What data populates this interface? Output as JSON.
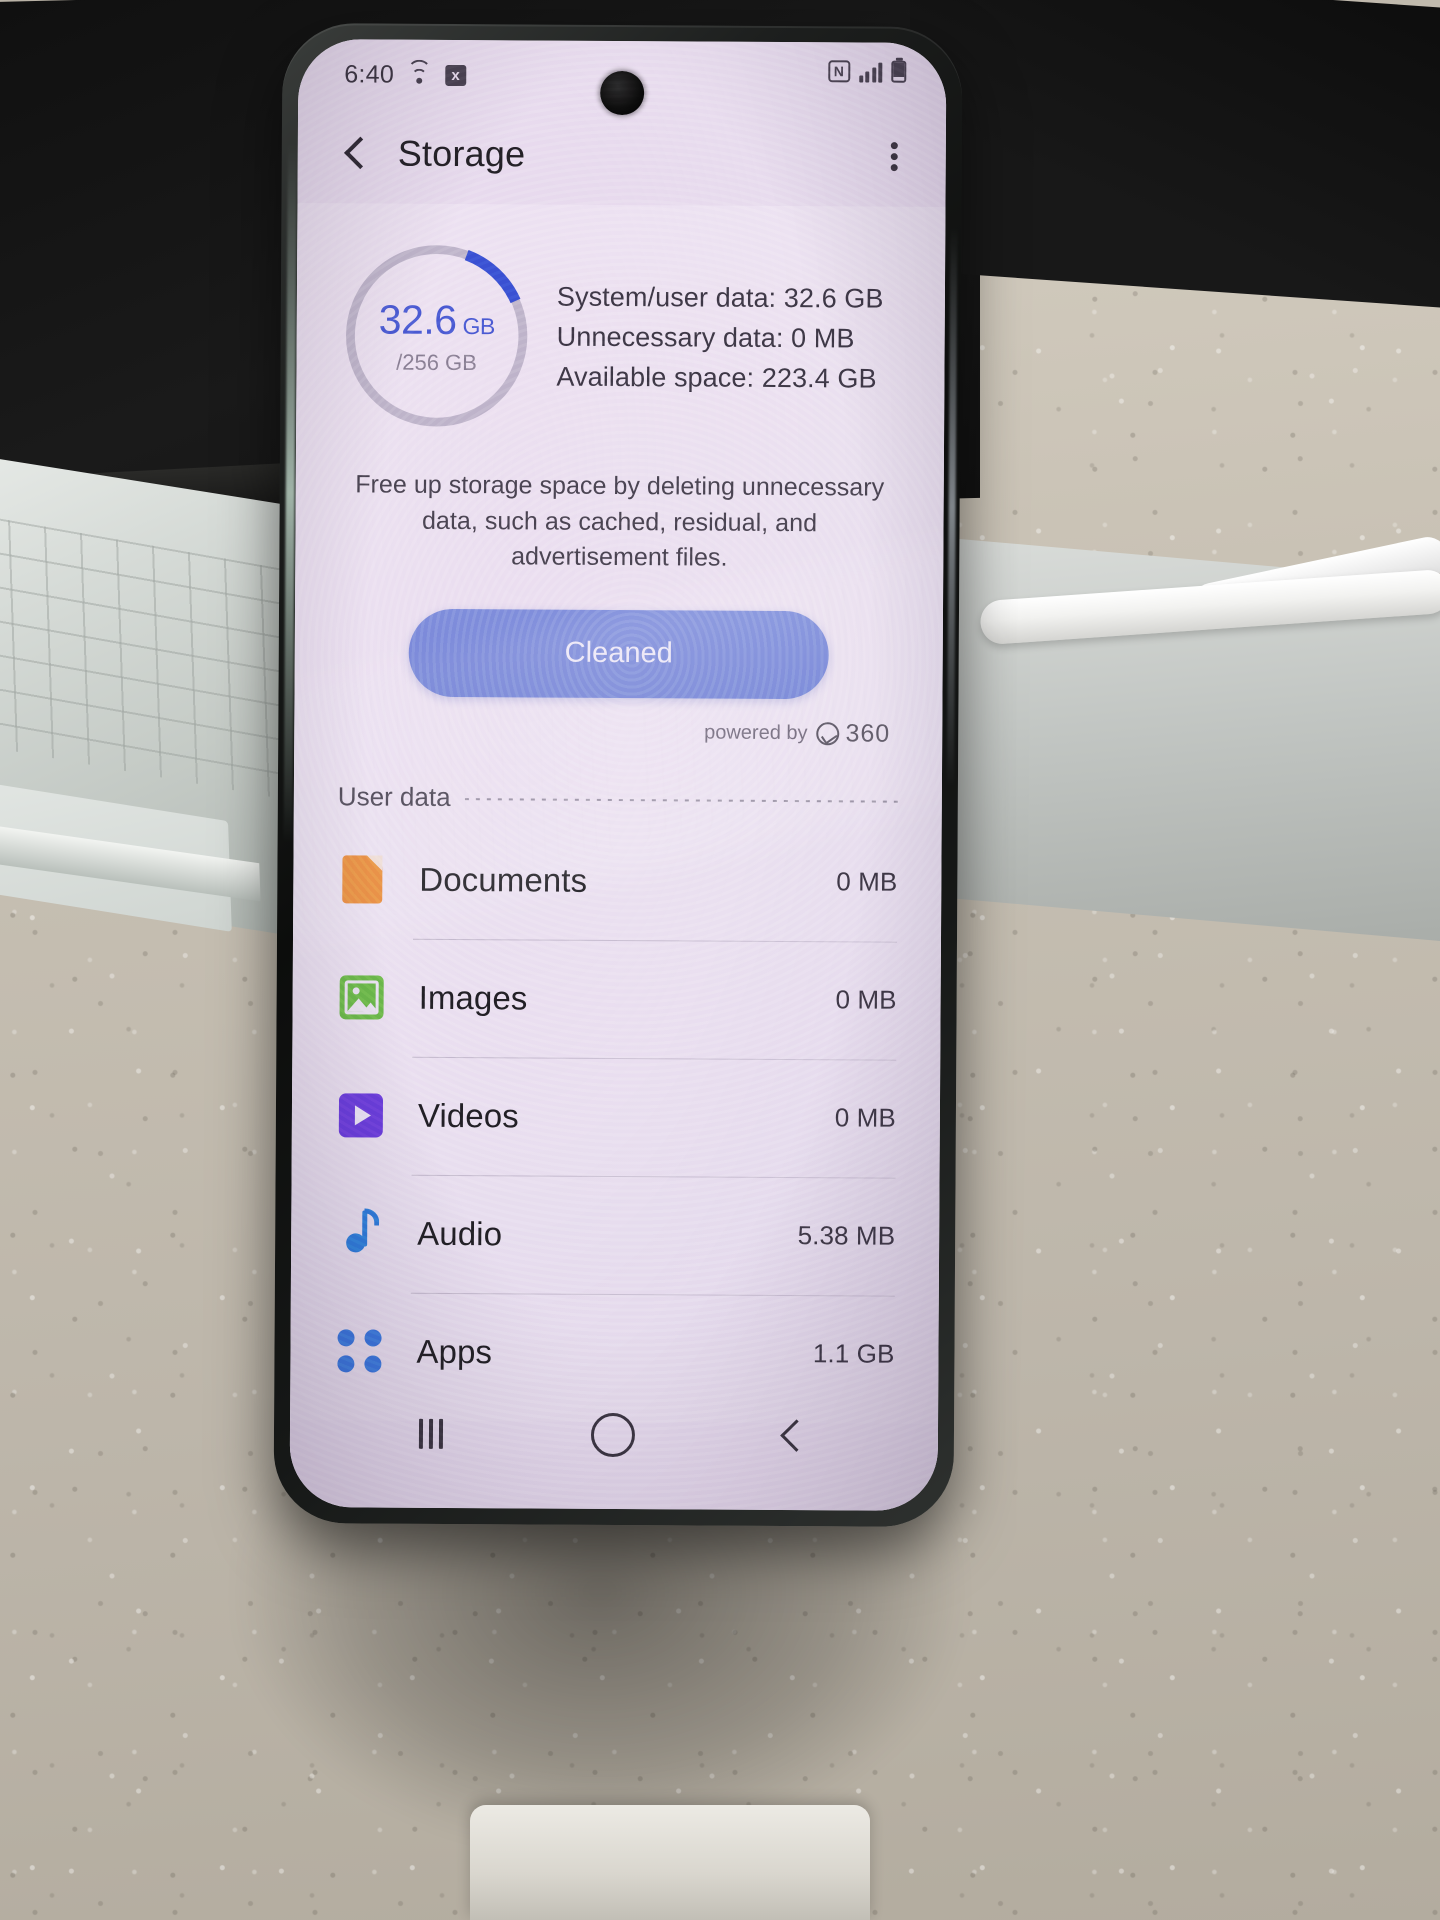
{
  "status_bar": {
    "time": "6:40",
    "icons_left": [
      "wifi-icon",
      "x-badge-icon"
    ],
    "icons_right": [
      "nfc-icon",
      "signal-bars-icon",
      "battery-icon"
    ],
    "nfc_label": "N",
    "x_label": "x"
  },
  "app_bar": {
    "title": "Storage",
    "back_icon": "back-arrow-icon",
    "overflow_icon": "more-options-icon"
  },
  "summary": {
    "ring": {
      "used_value": "32.6",
      "used_unit": "GB",
      "total_label": "/256 GB",
      "percent_used": 12.7,
      "arc_color": "#3a53d6",
      "track_color": "#c3bccd"
    },
    "lines": [
      "System/user data: 32.6 GB",
      "Unnecessary data: 0 MB",
      "Available space: 223.4 GB"
    ]
  },
  "description": "Free up storage space by deleting unnecessary data, such as cached, residual, and advertisement files.",
  "clean_button": {
    "label": "Cleaned",
    "color": "#7b8ddb"
  },
  "powered_by": {
    "prefix": "powered by",
    "brand": "360",
    "icon": "360-logo-icon"
  },
  "user_data": {
    "section_label": "User data",
    "items": [
      {
        "icon": "document-icon",
        "name": "Documents",
        "size": "0 MB",
        "color": "#ef8f3c"
      },
      {
        "icon": "image-icon",
        "name": "Images",
        "size": "0 MB",
        "color": "#6cc04a"
      },
      {
        "icon": "video-icon",
        "name": "Videos",
        "size": "0 MB",
        "color": "#6b3fe0"
      },
      {
        "icon": "audio-icon",
        "name": "Audio",
        "size": "5.38 MB",
        "color": "#2f7fe0"
      },
      {
        "icon": "apps-icon",
        "name": "Apps",
        "size": "1.1 GB",
        "color": "#3b7ae4"
      }
    ]
  },
  "nav_bar": {
    "recents_icon": "recents-icon",
    "home_icon": "home-icon",
    "back_icon": "nav-back-icon"
  }
}
